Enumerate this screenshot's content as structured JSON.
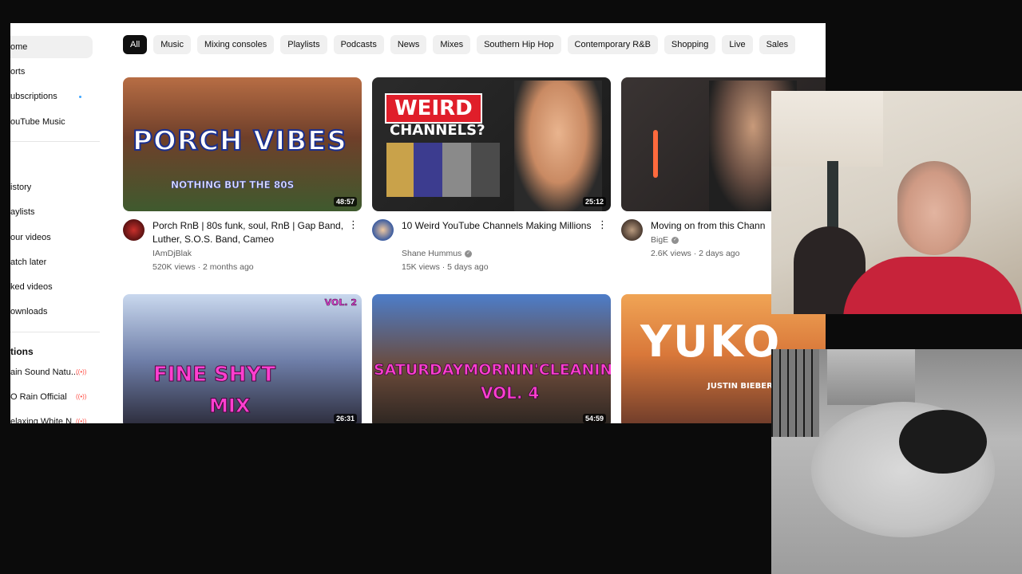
{
  "sidebar": {
    "items": [
      {
        "label": "ome"
      },
      {
        "label": "orts"
      },
      {
        "label": "ubscriptions"
      },
      {
        "label": "ouTube Music"
      },
      {
        "label": "istory"
      },
      {
        "label": "aylists"
      },
      {
        "label": "our videos"
      },
      {
        "label": "atch later"
      },
      {
        "label": "ked videos"
      },
      {
        "label": "ownloads"
      }
    ],
    "subs_heading": "tions",
    "subs": [
      {
        "label": "ain Sound Natu..."
      },
      {
        "label": "O Rain Official"
      },
      {
        "label": "elaxing White N..."
      }
    ]
  },
  "chips": [
    {
      "label": "All",
      "active": true
    },
    {
      "label": "Music"
    },
    {
      "label": "Mixing consoles"
    },
    {
      "label": "Playlists"
    },
    {
      "label": "Podcasts"
    },
    {
      "label": "News"
    },
    {
      "label": "Mixes"
    },
    {
      "label": "Southern Hip Hop"
    },
    {
      "label": "Contemporary R&B"
    },
    {
      "label": "Shopping"
    },
    {
      "label": "Live"
    },
    {
      "label": "Sales"
    }
  ],
  "videos": [
    {
      "thumb_title": "PORCH VIBES",
      "thumb_sub": "NOTHING BUT THE 80S",
      "duration": "48:57",
      "title": "Porch RnB | 80s funk, soul, RnB | Gap Band, Luther, S.O.S. Band, Cameo",
      "channel": "IAmDjBlak",
      "stats": "520K views · 2 months ago"
    },
    {
      "thumb_title": "WEIRD",
      "thumb_sub": "CHANNELS?",
      "duration": "25:12",
      "title": "10 Weird YouTube Channels Making Millions",
      "channel": "Shane Hummus",
      "stats": "15K views · 5 days ago"
    },
    {
      "thumb_title": "",
      "duration": "",
      "title": "Moving on from this Chann",
      "channel": "BigE",
      "stats": "2.6K views · 2 days ago"
    },
    {
      "thumb_title": "FINE SHYT",
      "thumb_sub": "MIX",
      "thumb_tag": "VOL. 2",
      "duration": "26:31"
    },
    {
      "thumb_title": "SATURDAYMORNIN'CLEANIN'",
      "thumb_sub": "VOL. 4",
      "duration": "54:59"
    },
    {
      "thumb_title": "YUKO",
      "thumb_sub": "JUSTIN BIEBER"
    }
  ]
}
